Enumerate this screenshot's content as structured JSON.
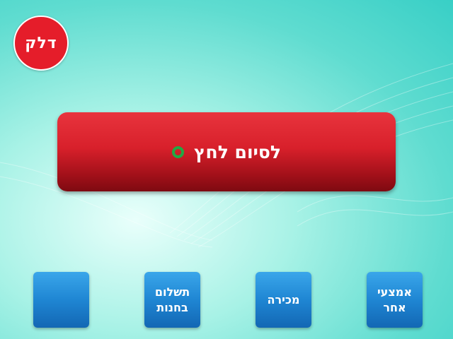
{
  "brand": {
    "logo_text": "דלק",
    "logo_color": "#e51d2a"
  },
  "finish_button": {
    "label": "לסיום לחץ",
    "color": "#d8202b"
  },
  "status_indicator": {
    "icon": "ring-icon",
    "color": "#22a944"
  },
  "bottom_buttons": [
    {
      "label": ""
    },
    {
      "label": "תשלום\nבחנות"
    },
    {
      "label": "מכירה"
    },
    {
      "label": "אמצעי\nאחר"
    }
  ],
  "colors": {
    "accent_blue": "#1f86d3",
    "background": "#5fdcd0"
  }
}
